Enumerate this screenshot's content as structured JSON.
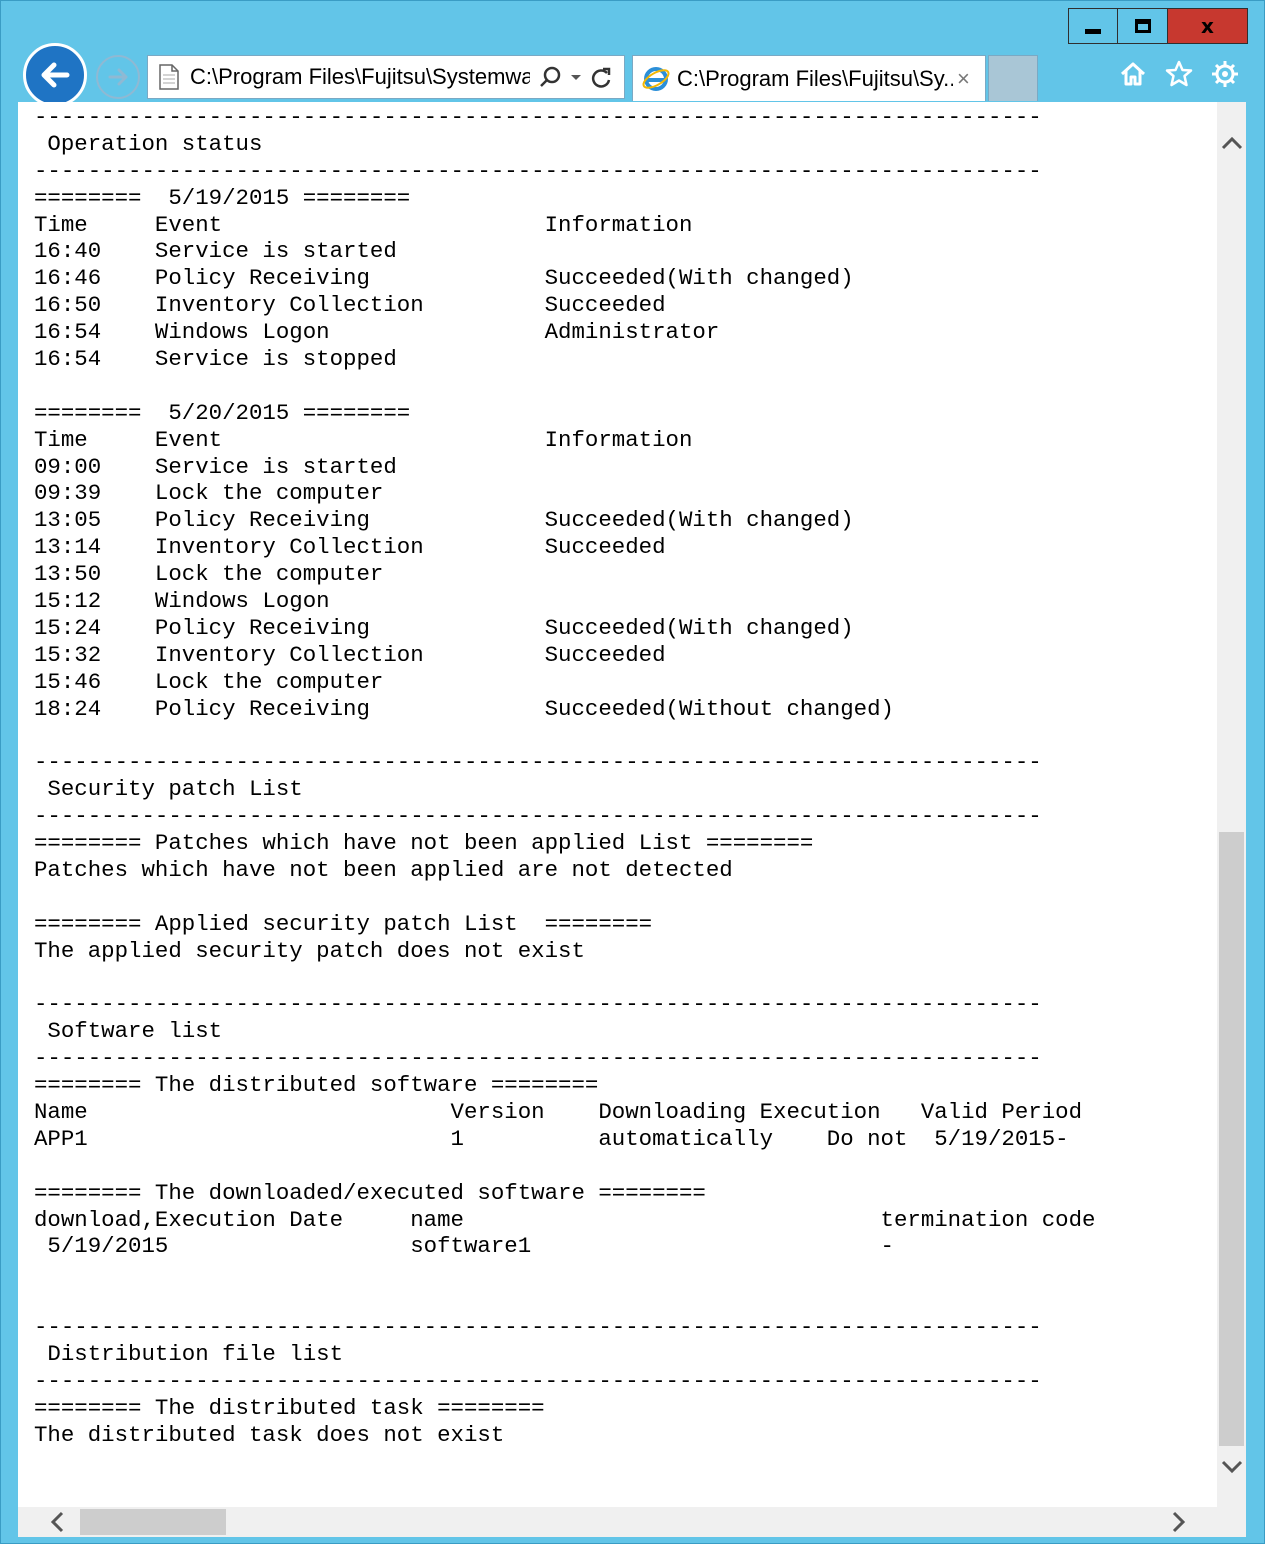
{
  "window": {
    "minimize_icon": "minimize-icon",
    "maximize_icon": "maximize-icon",
    "close_label": "x"
  },
  "toolbar": {
    "back_icon": "back-arrow-icon",
    "forward_icon": "forward-arrow-icon",
    "address": "C:\\Program Files\\Fujitsu\\Systemwa",
    "tab_title": "C:\\Program Files\\Fujitsu\\Sy...",
    "tab_close": "×",
    "search_icon": "search-icon",
    "dropdown_icon": "chevron-down-icon",
    "refresh_icon": "refresh-icon",
    "home_icon": "home-icon",
    "favorites_icon": "star-icon",
    "settings_icon": "gear-icon"
  },
  "report_lines": [
    "---------------------------------------------------------------------------",
    " Operation status",
    "---------------------------------------------------------------------------",
    "========  5/19/2015 ========",
    "Time     Event                        Information",
    "16:40    Service is started",
    "16:46    Policy Receiving             Succeeded(With changed)",
    "16:50    Inventory Collection         Succeeded",
    "16:54    Windows Logon                Administrator",
    "16:54    Service is stopped",
    "",
    "========  5/20/2015 ========",
    "Time     Event                        Information",
    "09:00    Service is started",
    "09:39    Lock the computer",
    "13:05    Policy Receiving             Succeeded(With changed)",
    "13:14    Inventory Collection         Succeeded",
    "13:50    Lock the computer",
    "15:12    Windows Logon",
    "15:24    Policy Receiving             Succeeded(With changed)",
    "15:32    Inventory Collection         Succeeded",
    "15:46    Lock the computer",
    "18:24    Policy Receiving             Succeeded(Without changed)",
    "",
    "---------------------------------------------------------------------------",
    " Security patch List",
    "---------------------------------------------------------------------------",
    "======== Patches which have not been applied List ========",
    "Patches which have not been applied are not detected",
    "",
    "======== Applied security patch List  ========",
    "The applied security patch does not exist",
    "",
    "---------------------------------------------------------------------------",
    " Software list",
    "---------------------------------------------------------------------------",
    "======== The distributed software ========",
    "Name                           Version    Downloading Execution   Valid Period",
    "APP1                           1          automatically    Do not  5/19/2015-",
    "",
    "======== The downloaded/executed software ========",
    "download,Execution Date     name                               termination code",
    " 5/19/2015                  software1                          -",
    "",
    "",
    "---------------------------------------------------------------------------",
    " Distribution file list",
    "---------------------------------------------------------------------------",
    "======== The distributed task ========",
    "The distributed task does not exist"
  ],
  "scrollbars": {
    "up_icon": "chevron-up-icon",
    "down_icon": "chevron-down-icon",
    "left_icon": "chevron-left-icon",
    "right_icon": "chevron-right-icon",
    "vertical_position": 0.62,
    "horizontal_position": 0.03
  }
}
